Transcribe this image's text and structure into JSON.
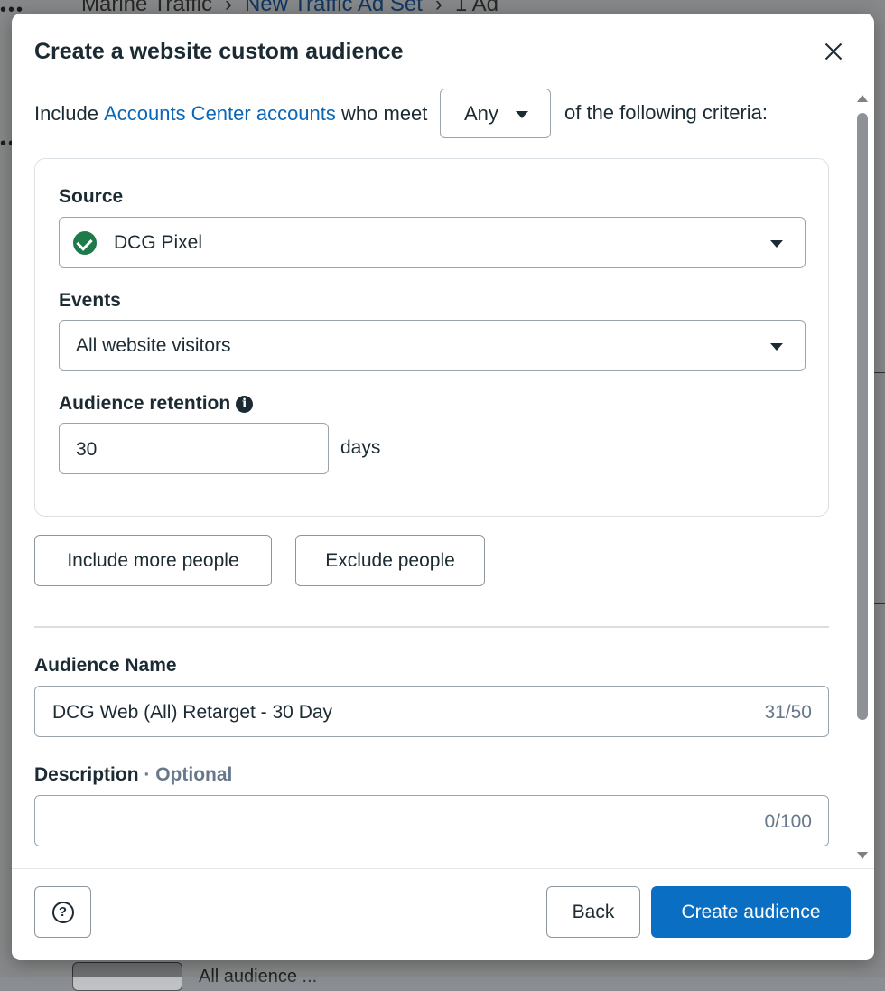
{
  "background": {
    "breadcrumb": [
      "Marine Traffic",
      "New Traffic Ad Set",
      "1 Ad"
    ],
    "bottom_text": "All audience ..."
  },
  "modal": {
    "title": "Create a website custom audience",
    "criteria": {
      "prefix": "Include",
      "link": "Accounts Center accounts",
      "middle": "who meet",
      "match_value": "Any",
      "suffix": "of the following criteria:"
    },
    "rule": {
      "source_label": "Source",
      "source_value": "DCG Pixel",
      "events_label": "Events",
      "events_value": "All website visitors",
      "retention_label": "Audience retention",
      "retention_value": "30",
      "retention_unit": "days"
    },
    "include_more_label": "Include more people",
    "exclude_label": "Exclude people",
    "audience_name_label": "Audience Name",
    "audience_name_value": "DCG Web (All) Retarget - 30 Day",
    "audience_name_counter": "31/50",
    "description_label": "Description",
    "description_optional": "· Optional",
    "description_value": "",
    "description_counter": "0/100"
  },
  "footer": {
    "help_label": "?",
    "back_label": "Back",
    "create_label": "Create audience"
  },
  "colors": {
    "primary": "#0a6fc2",
    "link": "#0a66b7",
    "success": "#1f7a4a",
    "text": "#1c2b33"
  }
}
